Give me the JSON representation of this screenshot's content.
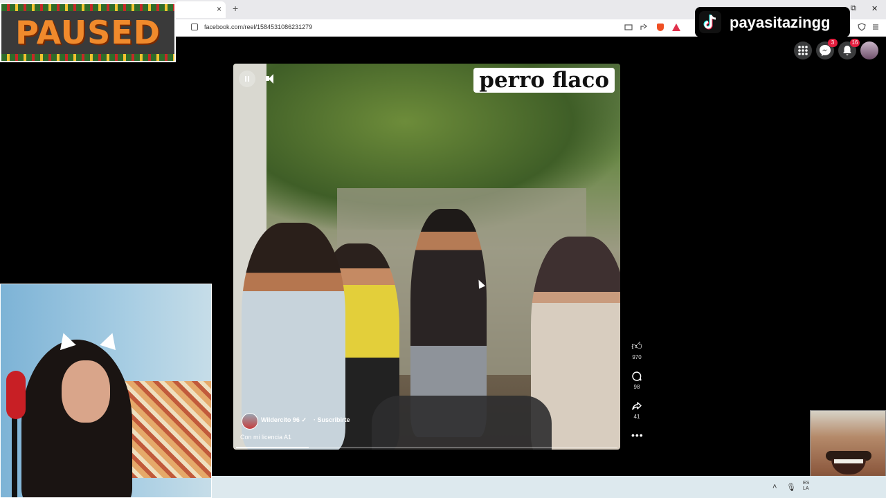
{
  "browser": {
    "tab_close": "×",
    "new_tab": "+",
    "window_min": "─",
    "window_max": "⧉",
    "window_close": "✕",
    "url": "facebook.com/reel/1584531086231279"
  },
  "overlay": {
    "paused_text": "PAUSED"
  },
  "watermark": {
    "name": "payasitazingg"
  },
  "fb_header": {
    "messenger_badge": "3",
    "notifications_badge": "16"
  },
  "reel": {
    "caption": "perro flaco",
    "author": "Wildercito 96",
    "verified_mark": "✓",
    "subscribe": "· Suscribirte",
    "description": "Con mi licencia A1",
    "progress": 0.19,
    "likes": "970",
    "comments": "98",
    "shares": "41",
    "more": "•••"
  },
  "taskbar": {
    "chevron": "˄",
    "mic": "🎙",
    "lang": "ES\nLA"
  }
}
